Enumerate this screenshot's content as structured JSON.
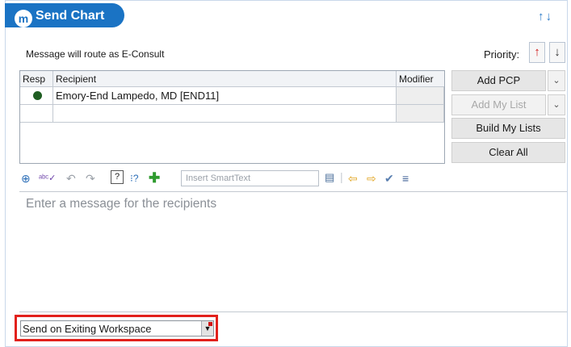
{
  "window": {
    "title": "Send Chart",
    "logo_glyph": "m"
  },
  "route_message": "Message will route as E-Consult",
  "priority": {
    "label": "Priority:",
    "up_color": "#d01414",
    "down_color": "#333333"
  },
  "recipients_table": {
    "headers": [
      "Resp",
      "Recipient",
      "Modifier"
    ],
    "rows": [
      {
        "resp_icon": "respond-icon",
        "recipient": "Emory-End Lampedo, MD [END11]",
        "modifier": ""
      }
    ]
  },
  "side_buttons": {
    "add_pcp": "Add PCP",
    "add_my_list": "Add My List",
    "build_my_lists": "Build My Lists",
    "clear_all": "Clear All"
  },
  "toolbar": {
    "smarttext_placeholder": "Insert SmartText"
  },
  "message": {
    "placeholder": "Enter a message for the recipients"
  },
  "send_option": {
    "selected": "Send on Exiting Workspace"
  },
  "colors": {
    "accent": "#1a73c4",
    "highlight": "#e2211c"
  }
}
